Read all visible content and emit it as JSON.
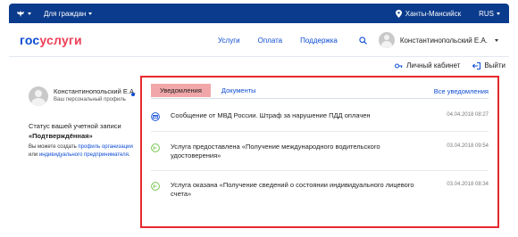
{
  "topbar": {
    "audience": "Для граждан",
    "location": "Ханты-Мансийск",
    "language": "RUS"
  },
  "header": {
    "logo_part1": "гос",
    "logo_part2": "услуги",
    "nav": [
      "Услуги",
      "Оплата",
      "Поддержка"
    ],
    "user_name": "Константинопольский Е.А."
  },
  "subheader": {
    "cabinet": "Личный кабинет",
    "exit": "Выйти"
  },
  "profile": {
    "name": "Константинопольский Е.А.",
    "subtitle": "Ваш персональный профиль",
    "status_label": "Статус вашей учетной записи",
    "status_value": "«Подтверждённая»",
    "info_prefix": "Вы можете создать",
    "link1": "профиль организации",
    "info_or": "или",
    "link2": "индивидуального предпринимателя",
    "info_suffix": "."
  },
  "notifications_panel": {
    "tab_active": "Уведомления",
    "tab_docs": "Документы",
    "all_link": "Все уведомления",
    "items": [
      {
        "text": "Сообщение от МВД России. Штраф за нарушение ПДД оплачен",
        "time": "04.04.2018 08:27",
        "icon": "police-message-icon"
      },
      {
        "text": "Услуга предоставлена «Получение международного водительского удостоверения»",
        "time": "03.04.2018 09:54",
        "icon": "service-done-icon"
      },
      {
        "text": "Услуга оказана «Получение сведений о состоянии индивидуального лицевого счета»",
        "time": "03.04.2018 08:34",
        "icon": "service-done-icon"
      }
    ]
  },
  "colors": {
    "brand_blue": "#0d4cd3",
    "brand_red": "#ee3f58",
    "topbar": "#0b3b8c",
    "frame_red": "#e8282f",
    "active_tab": "#f1a7a9",
    "icon_green": "#6cbf3f"
  }
}
